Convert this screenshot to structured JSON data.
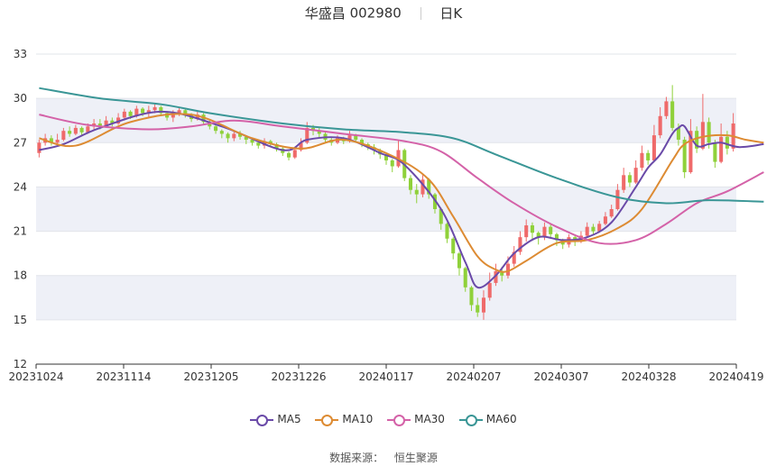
{
  "header": {
    "stock_name": "华盛昌",
    "stock_code": "002980",
    "period": "日K"
  },
  "source": {
    "label": "数据来源：",
    "provider": "恒生聚源"
  },
  "colors": {
    "up": "#ef6a6a",
    "down": "#8fd13a",
    "ma5": "#6a4aa8",
    "ma10": "#dd8b33",
    "ma30": "#d462a8",
    "ma60": "#3a9696",
    "band": "#eef0f7",
    "grid": "#e2e4ea",
    "axis": "#333333"
  },
  "chart_data": {
    "type": "candlestick",
    "x_tick_labels": [
      "20231024",
      "20231114",
      "20231205",
      "20231226",
      "20240117",
      "20240207",
      "20240307",
      "20240328",
      "20240419"
    ],
    "y_ticks": [
      12,
      15,
      18,
      21,
      24,
      27,
      30,
      33
    ],
    "ylim": [
      12,
      33
    ],
    "grid": true,
    "legend_position": "bottom",
    "legend": [
      "MA5",
      "MA10",
      "MA30",
      "MA60"
    ],
    "candles": [
      [
        26.3,
        27.0,
        27.2,
        26.0
      ],
      [
        27.0,
        27.3,
        27.6,
        26.8
      ],
      [
        27.3,
        27.0,
        27.5,
        26.8
      ],
      [
        27.0,
        27.2,
        27.6,
        26.9
      ],
      [
        27.2,
        27.8,
        28.0,
        27.1
      ],
      [
        27.8,
        27.6,
        28.1,
        27.4
      ],
      [
        27.6,
        28.0,
        28.2,
        27.5
      ],
      [
        28.0,
        27.7,
        28.1,
        27.5
      ],
      [
        27.7,
        28.1,
        28.3,
        27.6
      ],
      [
        28.1,
        28.3,
        28.6,
        27.9
      ],
      [
        28.3,
        28.1,
        28.6,
        27.9
      ],
      [
        28.1,
        28.5,
        28.8,
        28.0
      ],
      [
        28.5,
        28.3,
        28.7,
        28.1
      ],
      [
        28.3,
        28.7,
        29.0,
        28.2
      ],
      [
        28.7,
        29.1,
        29.3,
        28.5
      ],
      [
        29.1,
        28.8,
        29.2,
        28.6
      ],
      [
        28.8,
        29.3,
        29.5,
        28.7
      ],
      [
        29.3,
        29.0,
        29.4,
        28.8
      ],
      [
        29.0,
        29.2,
        29.5,
        28.7
      ],
      [
        29.2,
        29.4,
        29.6,
        29.0
      ],
      [
        29.4,
        29.0,
        29.5,
        28.8
      ],
      [
        29.0,
        28.7,
        29.1,
        28.5
      ],
      [
        28.7,
        29.0,
        29.2,
        28.4
      ],
      [
        29.0,
        29.2,
        29.4,
        28.8
      ],
      [
        29.2,
        28.9,
        29.3,
        28.7
      ],
      [
        28.9,
        28.6,
        29.0,
        28.4
      ],
      [
        28.6,
        28.9,
        29.1,
        28.5
      ],
      [
        28.9,
        28.4,
        29.0,
        28.2
      ],
      [
        28.4,
        28.1,
        28.5,
        27.9
      ],
      [
        28.1,
        27.8,
        28.2,
        27.6
      ],
      [
        27.8,
        27.6,
        27.9,
        27.3
      ],
      [
        27.6,
        27.3,
        27.7,
        27.0
      ],
      [
        27.3,
        27.6,
        27.8,
        27.1
      ],
      [
        27.6,
        27.4,
        27.8,
        27.2
      ],
      [
        27.4,
        27.2,
        27.5,
        26.9
      ],
      [
        27.2,
        27.0,
        27.3,
        26.8
      ],
      [
        27.0,
        26.8,
        27.1,
        26.6
      ],
      [
        26.8,
        27.1,
        27.3,
        26.6
      ],
      [
        27.1,
        26.9,
        27.2,
        26.7
      ],
      [
        26.9,
        26.6,
        27.0,
        26.4
      ],
      [
        26.6,
        26.3,
        26.7,
        26.1
      ],
      [
        26.3,
        26.0,
        26.4,
        25.8
      ],
      [
        26.0,
        26.5,
        26.7,
        25.9
      ],
      [
        26.5,
        27.0,
        27.3,
        26.4
      ],
      [
        27.0,
        28.0,
        28.4,
        26.9
      ],
      [
        28.0,
        27.8,
        28.2,
        27.5
      ],
      [
        27.8,
        27.6,
        28.0,
        27.3
      ],
      [
        27.6,
        27.2,
        27.7,
        27.0
      ],
      [
        27.2,
        27.0,
        27.4,
        26.8
      ],
      [
        27.0,
        27.3,
        27.5,
        26.9
      ],
      [
        27.3,
        27.1,
        27.4,
        26.9
      ],
      [
        27.1,
        27.5,
        27.8,
        27.0
      ],
      [
        27.5,
        27.2,
        27.6,
        27.0
      ],
      [
        27.2,
        26.9,
        27.3,
        26.7
      ],
      [
        26.9,
        26.7,
        27.0,
        26.5
      ],
      [
        26.7,
        26.5,
        26.9,
        26.2
      ],
      [
        26.5,
        26.2,
        26.6,
        25.9
      ],
      [
        26.2,
        25.8,
        26.3,
        25.5
      ],
      [
        25.8,
        25.4,
        25.9,
        25.0
      ],
      [
        25.4,
        26.5,
        27.2,
        25.3
      ],
      [
        26.5,
        24.6,
        26.6,
        24.4
      ],
      [
        24.6,
        23.8,
        24.8,
        23.5
      ],
      [
        23.8,
        23.5,
        24.2,
        22.9
      ],
      [
        23.5,
        24.5,
        24.8,
        23.3
      ],
      [
        24.5,
        23.5,
        24.6,
        23.2
      ],
      [
        23.5,
        22.5,
        23.6,
        22.2
      ],
      [
        22.5,
        21.5,
        22.6,
        21.1
      ],
      [
        21.5,
        20.5,
        21.6,
        20.2
      ],
      [
        20.5,
        19.5,
        20.6,
        19.1
      ],
      [
        19.5,
        18.5,
        19.6,
        18.0
      ],
      [
        18.5,
        17.2,
        18.6,
        16.9
      ],
      [
        17.2,
        16.0,
        17.3,
        15.6
      ],
      [
        16.0,
        15.5,
        16.5,
        15.2
      ],
      [
        15.5,
        16.5,
        17.0,
        15.0
      ],
      [
        16.5,
        17.5,
        18.2,
        16.3
      ],
      [
        17.5,
        18.3,
        18.8,
        17.3
      ],
      [
        18.3,
        18.0,
        18.6,
        17.6
      ],
      [
        18.0,
        18.8,
        19.3,
        17.8
      ],
      [
        18.8,
        19.6,
        20.0,
        18.6
      ],
      [
        19.6,
        20.6,
        21.0,
        19.4
      ],
      [
        20.6,
        21.4,
        21.8,
        20.3
      ],
      [
        21.4,
        20.9,
        21.6,
        20.4
      ],
      [
        20.9,
        20.6,
        21.0,
        20.1
      ],
      [
        20.6,
        21.3,
        21.6,
        20.4
      ],
      [
        21.3,
        20.8,
        21.5,
        20.5
      ],
      [
        20.8,
        20.4,
        20.9,
        20.0
      ],
      [
        20.4,
        20.1,
        20.5,
        19.8
      ],
      [
        20.1,
        20.6,
        20.8,
        19.9
      ],
      [
        20.6,
        20.3,
        20.7,
        20.0
      ],
      [
        20.3,
        20.7,
        21.0,
        20.2
      ],
      [
        20.7,
        21.3,
        21.6,
        20.6
      ],
      [
        21.3,
        21.0,
        21.5,
        20.8
      ],
      [
        21.0,
        21.5,
        21.7,
        20.9
      ],
      [
        21.5,
        22.0,
        22.3,
        21.4
      ],
      [
        22.0,
        22.5,
        22.8,
        21.9
      ],
      [
        22.5,
        23.8,
        24.2,
        22.4
      ],
      [
        23.8,
        24.8,
        25.3,
        23.6
      ],
      [
        24.8,
        24.3,
        25.0,
        24.0
      ],
      [
        24.3,
        25.3,
        25.8,
        24.2
      ],
      [
        25.3,
        26.3,
        26.8,
        25.1
      ],
      [
        26.3,
        25.8,
        26.5,
        25.5
      ],
      [
        25.8,
        27.5,
        28.2,
        25.7
      ],
      [
        27.5,
        28.8,
        29.4,
        27.3
      ],
      [
        28.8,
        29.8,
        30.1,
        28.6
      ],
      [
        29.8,
        28.0,
        30.9,
        27.8
      ],
      [
        28.0,
        27.2,
        28.3,
        26.8
      ],
      [
        27.2,
        25.0,
        27.4,
        24.6
      ],
      [
        25.0,
        27.8,
        28.6,
        24.9
      ],
      [
        27.8,
        26.6,
        28.1,
        26.3
      ],
      [
        26.6,
        28.4,
        30.3,
        26.5
      ],
      [
        28.4,
        27.0,
        28.7,
        26.6
      ],
      [
        27.0,
        25.7,
        27.2,
        25.3
      ],
      [
        25.7,
        27.4,
        28.3,
        25.6
      ],
      [
        27.4,
        26.6,
        27.8,
        26.2
      ],
      [
        26.6,
        28.3,
        29.0,
        26.4
      ]
    ],
    "series": [
      {
        "name": "MA5",
        "points": [
          [
            0,
            26.5
          ],
          [
            4,
            26.9
          ],
          [
            10,
            28.0
          ],
          [
            20,
            29.1
          ],
          [
            30,
            28.1
          ],
          [
            40,
            26.5
          ],
          [
            44,
            27.2
          ],
          [
            50,
            27.3
          ],
          [
            56,
            26.3
          ],
          [
            60,
            25.5
          ],
          [
            66,
            22.5
          ],
          [
            70,
            18.9
          ],
          [
            72,
            17.2
          ],
          [
            75,
            18.0
          ],
          [
            78,
            19.5
          ],
          [
            82,
            20.6
          ],
          [
            86,
            20.4
          ],
          [
            90,
            20.6
          ],
          [
            94,
            21.6
          ],
          [
            98,
            24.0
          ],
          [
            100,
            25.3
          ],
          [
            102,
            26.2
          ],
          [
            104,
            27.6
          ],
          [
            105,
            28.0
          ],
          [
            106,
            28.1
          ],
          [
            108,
            26.8
          ],
          [
            110,
            26.9
          ],
          [
            112,
            27.0
          ],
          [
            115,
            26.7
          ],
          [
            119,
            26.9
          ]
        ]
      },
      {
        "name": "MA10",
        "points": [
          [
            0,
            27.3
          ],
          [
            6,
            26.8
          ],
          [
            15,
            28.4
          ],
          [
            25,
            28.9
          ],
          [
            35,
            27.3
          ],
          [
            43,
            26.6
          ],
          [
            50,
            27.2
          ],
          [
            58,
            26.1
          ],
          [
            64,
            24.5
          ],
          [
            68,
            22.0
          ],
          [
            72,
            19.3
          ],
          [
            75,
            18.4
          ],
          [
            77,
            18.3
          ],
          [
            80,
            19.0
          ],
          [
            85,
            20.2
          ],
          [
            90,
            20.4
          ],
          [
            95,
            21.2
          ],
          [
            99,
            22.5
          ],
          [
            104,
            25.8
          ],
          [
            106,
            26.9
          ],
          [
            109,
            27.4
          ],
          [
            113,
            27.5
          ],
          [
            116,
            27.2
          ],
          [
            119,
            27.0
          ]
        ]
      },
      {
        "name": "MA30",
        "points": [
          [
            0,
            28.9
          ],
          [
            8,
            28.2
          ],
          [
            18,
            27.9
          ],
          [
            25,
            28.1
          ],
          [
            32,
            28.5
          ],
          [
            40,
            28.1
          ],
          [
            50,
            27.6
          ],
          [
            60,
            27.1
          ],
          [
            66,
            26.4
          ],
          [
            72,
            24.6
          ],
          [
            78,
            22.9
          ],
          [
            85,
            21.3
          ],
          [
            92,
            20.2
          ],
          [
            98,
            20.4
          ],
          [
            103,
            21.5
          ],
          [
            108,
            22.9
          ],
          [
            113,
            23.7
          ],
          [
            119,
            25.0
          ]
        ]
      },
      {
        "name": "MA60",
        "points": [
          [
            0,
            30.7
          ],
          [
            10,
            30.0
          ],
          [
            20,
            29.6
          ],
          [
            28,
            29.0
          ],
          [
            40,
            28.3
          ],
          [
            50,
            27.9
          ],
          [
            60,
            27.7
          ],
          [
            68,
            27.3
          ],
          [
            75,
            26.2
          ],
          [
            85,
            24.6
          ],
          [
            95,
            23.3
          ],
          [
            103,
            22.9
          ],
          [
            110,
            23.1
          ],
          [
            119,
            23.0
          ]
        ]
      }
    ]
  }
}
